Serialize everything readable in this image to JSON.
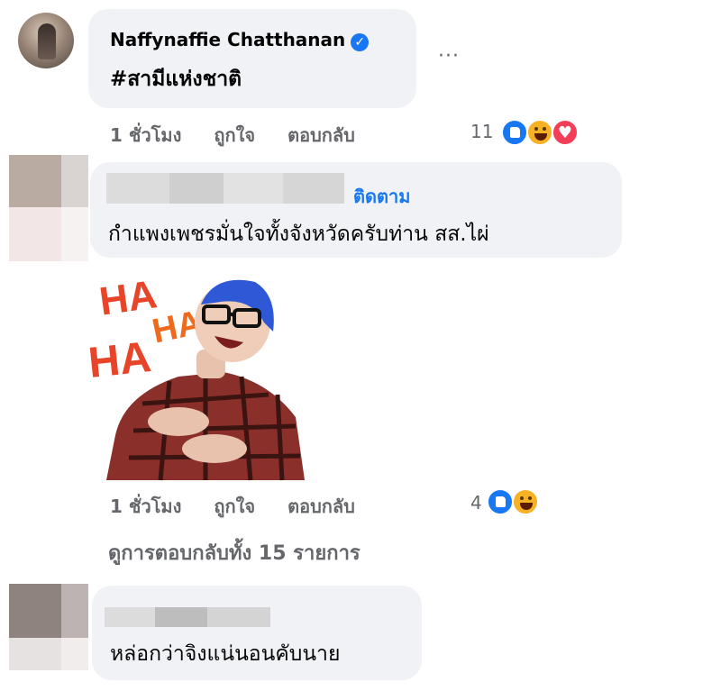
{
  "comment1": {
    "author": "Naffynaffie Chatthanan",
    "verified_icon": "verified-badge-icon",
    "text": "#สามีแห่งชาติ",
    "more": "···",
    "time": "1 ชั่วโมง",
    "like_label": "ถูกใจ",
    "reply_label": "ตอบกลับ",
    "reaction_count": "11",
    "reactions": [
      "like",
      "haha",
      "love"
    ]
  },
  "comment2": {
    "author_hidden": true,
    "follow_label": "ติดตาม",
    "text": "กำแพงเพชรมั่นใจทั้งจังหวัดครับท่าน สส.ไผ่",
    "sticker_text": [
      "HA",
      "HA",
      "HA"
    ],
    "time": "1 ชั่วโมง",
    "like_label": "ถูกใจ",
    "reply_label": "ตอบกลับ",
    "reaction_count": "4",
    "reactions": [
      "like",
      "haha"
    ]
  },
  "view_replies": "ดูการตอบกลับทั้ง 15 รายการ",
  "comment3": {
    "author_hidden": true,
    "text": "หล่อกว่าจิงแน่นอนคับนาย"
  },
  "colors": {
    "bubble": "#f0f2f5",
    "meta": "#65676b",
    "link": "#1877f2",
    "sticker_red": "#e8442a"
  }
}
